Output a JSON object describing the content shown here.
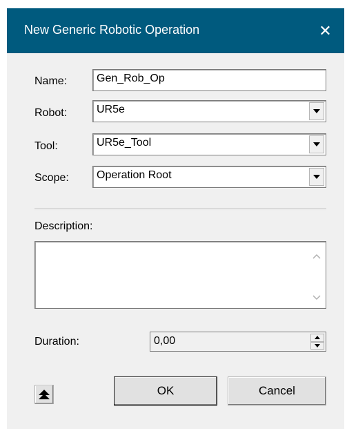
{
  "window": {
    "title": "New Generic Robotic Operation",
    "close_glyph": "✕"
  },
  "form": {
    "name_label": "Name:",
    "name_value": "Gen_Rob_Op",
    "robot_label": "Robot:",
    "robot_value": "UR5e",
    "tool_label": "Tool:",
    "tool_value": "UR5e_Tool",
    "scope_label": "Scope:",
    "scope_value": "Operation Root",
    "description_label": "Description:",
    "description_value": "",
    "duration_label": "Duration:",
    "duration_value": "0,00"
  },
  "buttons": {
    "ok_label": "OK",
    "cancel_label": "Cancel"
  },
  "icons": {
    "close": "close-icon",
    "dropdown": "chevron-down-icon",
    "collapse": "collapse-up-icon"
  },
  "colors": {
    "titlebar": "#005a7e",
    "dialog_bg": "#f0f0f0"
  }
}
